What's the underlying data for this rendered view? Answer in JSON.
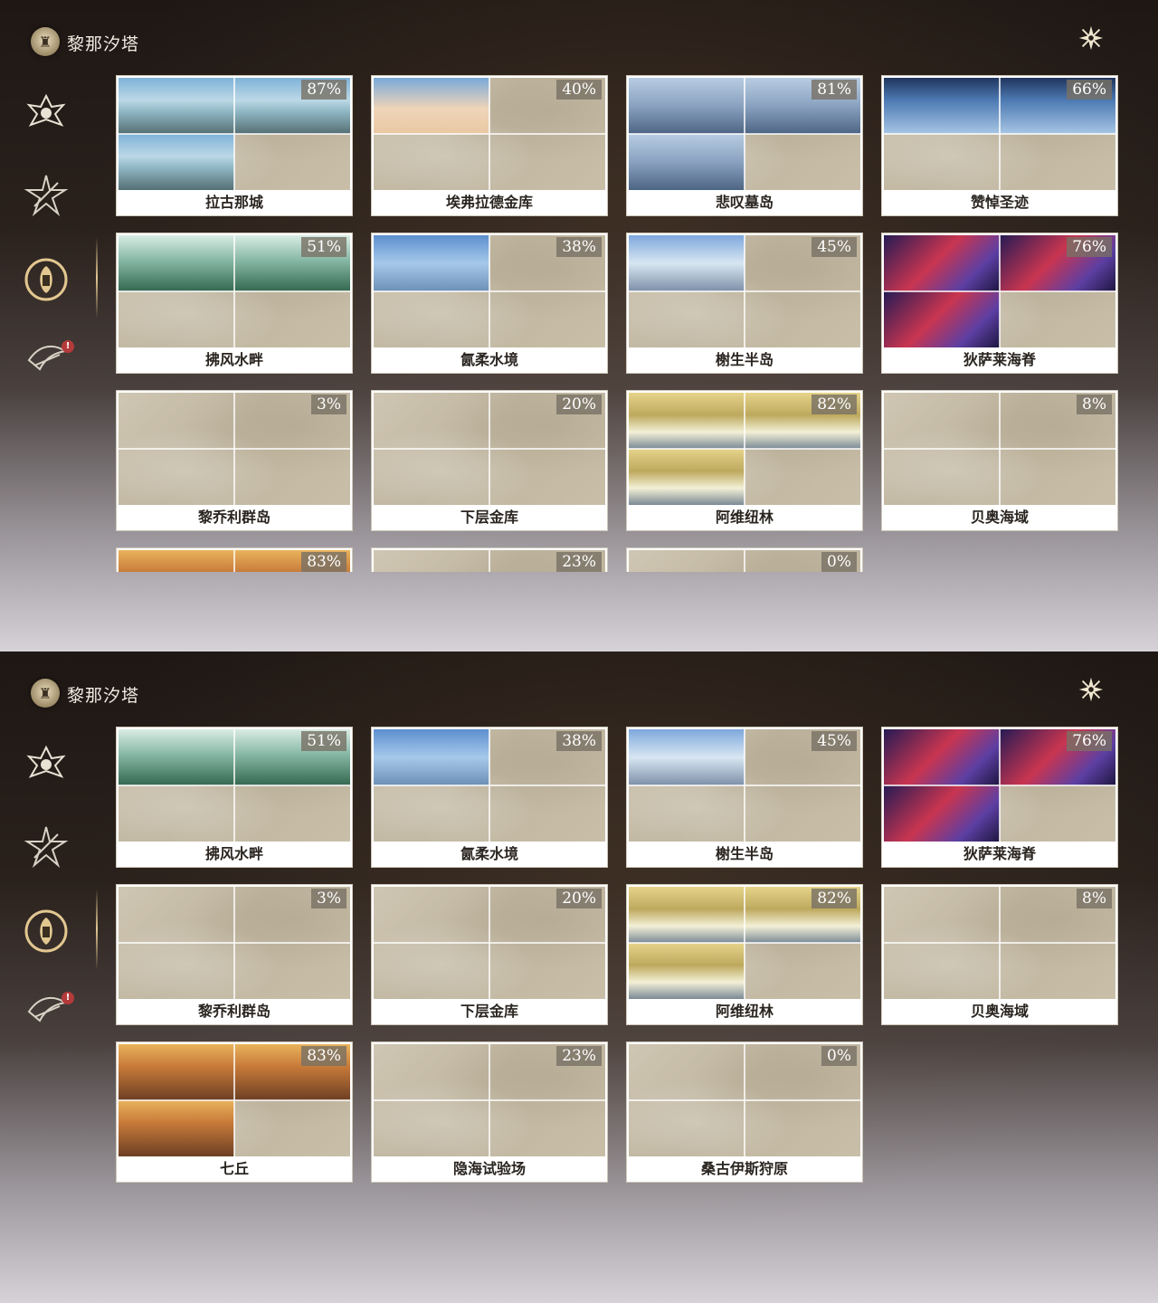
{
  "header": {
    "title": "黎那汐塔",
    "logo_icon": "region-emblem-icon",
    "close_icon": "close-x-icon"
  },
  "sidebar": {
    "items": [
      {
        "name": "sidebar-item-1",
        "icon": "dragon-crest-icon",
        "active": false
      },
      {
        "name": "sidebar-item-2",
        "icon": "star-crest-icon",
        "active": false
      },
      {
        "name": "sidebar-item-3",
        "icon": "rinascita-emblem-icon",
        "active": true
      },
      {
        "name": "sidebar-item-4",
        "icon": "wing-crest-icon",
        "active": false,
        "badge": "!"
      }
    ],
    "accent": "#e2c790"
  },
  "regions": [
    {
      "name": "拉古那城",
      "pct": "87%",
      "theme": "th-lagu",
      "q": [
        1,
        1,
        1,
        0
      ]
    },
    {
      "name": "埃弗拉德金库",
      "pct": "40%",
      "theme": "th-eflad",
      "q": [
        1,
        0,
        0,
        0
      ]
    },
    {
      "name": "悲叹墓岛",
      "pct": "81%",
      "theme": "th-beitan",
      "q": [
        1,
        1,
        1,
        0
      ]
    },
    {
      "name": "赞悼圣迹",
      "pct": "66%",
      "theme": "th-zan",
      "q": [
        1,
        1,
        0,
        0
      ]
    },
    {
      "name": "拂风水畔",
      "pct": "51%",
      "theme": "th-fufeng",
      "q": [
        1,
        1,
        0,
        0
      ]
    },
    {
      "name": "氤柔水境",
      "pct": "38%",
      "theme": "th-yarou",
      "q": [
        1,
        0,
        0,
        0
      ]
    },
    {
      "name": "榭生半岛",
      "pct": "45%",
      "theme": "th-xie",
      "q": [
        1,
        0,
        0,
        0
      ]
    },
    {
      "name": "狄萨莱海脊",
      "pct": "76%",
      "theme": "th-disa",
      "q": [
        1,
        1,
        1,
        0
      ]
    },
    {
      "name": "黎乔利群岛",
      "pct": "3%",
      "theme": "",
      "q": [
        0,
        0,
        0,
        0
      ]
    },
    {
      "name": "下层金库",
      "pct": "20%",
      "theme": "",
      "q": [
        0,
        0,
        0,
        0
      ]
    },
    {
      "name": "阿维纽林",
      "pct": "82%",
      "theme": "th-aweiniu",
      "q": [
        1,
        1,
        1,
        0
      ]
    },
    {
      "name": "贝奥海域",
      "pct": "8%",
      "theme": "",
      "q": [
        0,
        0,
        0,
        0
      ]
    },
    {
      "name": "七丘",
      "pct": "83%",
      "theme": "th-qiqiu",
      "q": [
        1,
        1,
        1,
        0
      ]
    },
    {
      "name": "隐海试验场",
      "pct": "23%",
      "theme": "",
      "q": [
        0,
        0,
        0,
        0
      ]
    },
    {
      "name": "桑古伊斯狩原",
      "pct": "0%",
      "theme": "",
      "q": [
        0,
        0,
        0,
        0
      ]
    }
  ],
  "panels": [
    {
      "id": "panel-1",
      "start": 0
    },
    {
      "id": "panel-2",
      "start": 4
    }
  ]
}
